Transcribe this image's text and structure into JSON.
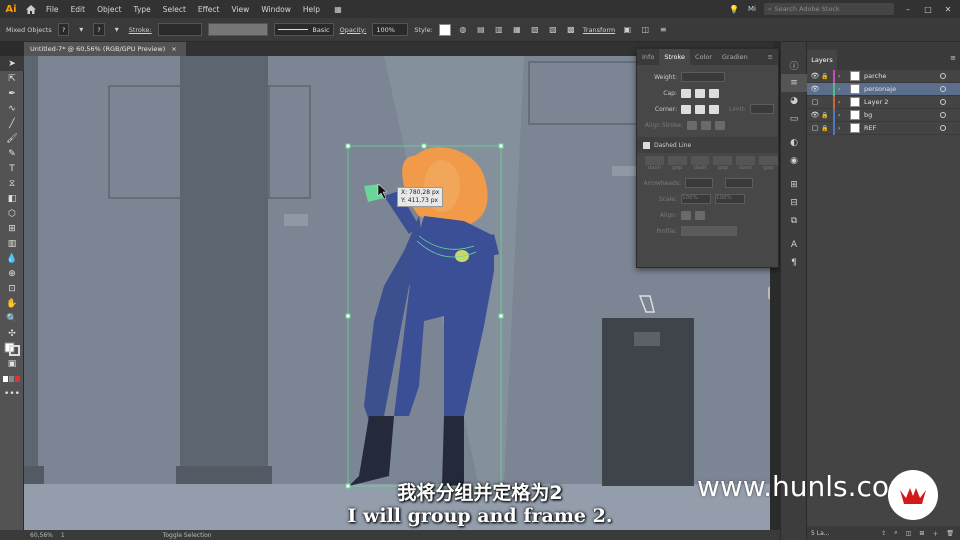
{
  "app": {
    "logo": "Ai",
    "account": "Mi",
    "search_placeholder": "Search Adobe Stock"
  },
  "menu": [
    "File",
    "Edit",
    "Object",
    "Type",
    "Select",
    "Effect",
    "View",
    "Window",
    "Help"
  ],
  "control_bar": {
    "selection_type": "Mixed Objects",
    "fill_value": "?",
    "stroke_value": "?",
    "stroke_label": "Stroke:",
    "brush_label": "Basic",
    "opacity_label": "Opacity:",
    "opacity_value": "100%",
    "style_label": "Style:",
    "transform_label": "Transform"
  },
  "document": {
    "tab_title": "Untitled-7* @ 60,56% (RGB/GPU Preview)",
    "close": "×"
  },
  "status_bar": {
    "zoom": "60,56%",
    "artboard": "1",
    "mode": "Toggle Selection"
  },
  "stroke_panel": {
    "tabs": [
      "Info",
      "Stroke",
      "Color",
      "Gradien"
    ],
    "active_tab": "Stroke",
    "weight_label": "Weight:",
    "cap_label": "Cap:",
    "corner_label": "Corner:",
    "limit_label": "Limit:",
    "align_label": "Align Stroke:",
    "dashed_label": "Dashed Line",
    "dash_labels": [
      "dash",
      "gap",
      "dash",
      "gap",
      "dash",
      "gap"
    ],
    "arrowheads_label": "Arrowheads:",
    "scale_label": "Scale:",
    "scale_value_1": "100%",
    "scale_value_2": "100%",
    "align_label2": "Align:",
    "profile_label": "Profile:"
  },
  "layers_panel": {
    "title": "Layers",
    "rows": [
      {
        "name": "parche",
        "color": "#c44ac4",
        "visible": true,
        "locked": true
      },
      {
        "name": "personaje",
        "color": "#4ac47a",
        "visible": true,
        "locked": false,
        "selected": true
      },
      {
        "name": "Layer 2",
        "color": "#c46a3a",
        "visible": false,
        "locked": false
      },
      {
        "name": "bg",
        "color": "#4a7ac4",
        "visible": true,
        "locked": true
      },
      {
        "name": "REF",
        "color": "#4a7ac4",
        "visible": false,
        "locked": true
      }
    ],
    "footer_count": "5 La..."
  },
  "canvas": {
    "tooltip_x": "X: 780,28 px",
    "tooltip_y": "Y: 411,73 px"
  },
  "subtitles": {
    "zh": "我将分组并定格为2",
    "en": "I will group and frame 2."
  },
  "watermark": "www.hunls.com"
}
